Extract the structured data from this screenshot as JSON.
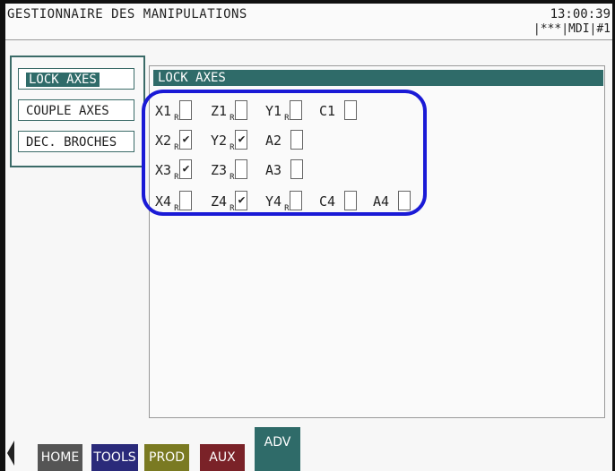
{
  "header": {
    "title": "GESTIONNAIRE DES MANIPULATIONS",
    "time": "13:00:39",
    "mode": "|***|MDI|#1"
  },
  "menu": {
    "items": [
      {
        "label": "LOCK AXES",
        "active": true
      },
      {
        "label": "COUPLE AXES",
        "active": false
      },
      {
        "label": "DEC. BROCHES",
        "active": false
      }
    ]
  },
  "panel": {
    "title": "LOCK AXES",
    "rows": [
      [
        {
          "name": "X1",
          "r": "R",
          "checked": false
        },
        {
          "name": "Z1",
          "r": "R",
          "checked": false
        },
        {
          "name": "Y1",
          "r": "R",
          "checked": false
        },
        {
          "name": "C1",
          "r": "",
          "checked": false
        }
      ],
      [
        {
          "name": "X2",
          "r": "R",
          "checked": true
        },
        {
          "name": "Y2",
          "r": "R",
          "checked": true
        },
        {
          "name": "A2",
          "r": "",
          "checked": false
        }
      ],
      [
        {
          "name": "X3",
          "r": "R",
          "checked": true
        },
        {
          "name": "Z3",
          "r": "R",
          "checked": false
        },
        {
          "name": "A3",
          "r": "",
          "checked": false
        }
      ],
      [
        {
          "name": "X4",
          "r": "R",
          "checked": false
        },
        {
          "name": "Z4",
          "r": "R",
          "checked": true
        },
        {
          "name": "Y4",
          "r": "R",
          "checked": false
        },
        {
          "name": "C4",
          "r": "",
          "checked": false
        },
        {
          "name": "A4",
          "r": "",
          "checked": false
        }
      ]
    ],
    "check_glyph": "✔"
  },
  "tabs": [
    {
      "label": "HOME",
      "color": "#555555"
    },
    {
      "label": "TOOLS",
      "color": "#2a2a7a"
    },
    {
      "label": "PROD",
      "color": "#7a7a22"
    },
    {
      "label": "AUX",
      "color": "#7a2228"
    },
    {
      "label": "ADV",
      "color": "#2f6b69"
    }
  ],
  "colors": {
    "accent": "#2f6b69",
    "highlight": "#1a1ad6"
  },
  "icons": {
    "left_arrow": "triangle-left-icon"
  }
}
